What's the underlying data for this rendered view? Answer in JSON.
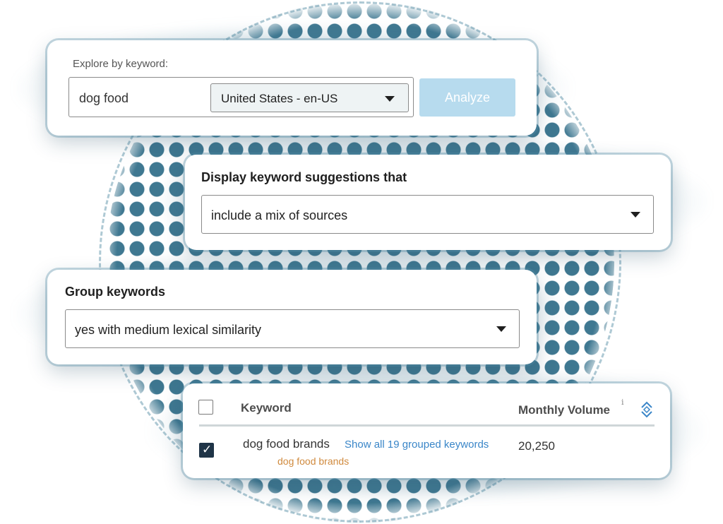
{
  "explore": {
    "label": "Explore by keyword:",
    "keyword_value": "dog food",
    "locale_selected": "United States - en-US",
    "analyze_label": "Analyze"
  },
  "display": {
    "title": "Display keyword suggestions that",
    "selected": "include a mix of sources"
  },
  "group": {
    "title": "Group keywords",
    "selected": "yes with medium lexical similarity"
  },
  "table": {
    "columns": {
      "keyword": "Keyword",
      "volume": "Monthly Volume",
      "info": "i"
    },
    "rows": [
      {
        "keyword": "dog food brands",
        "group_link": "Show all 19 grouped keywords",
        "group_name": "dog food brands",
        "volume": "20,250",
        "checked": true
      }
    ]
  },
  "colors": {
    "accent": "#3a86c8",
    "analyze_disabled": "#b7dbee",
    "group_label": "#d08a3e",
    "checkbox_checked": "#1f3447",
    "dot_pattern": "#3f7891"
  }
}
